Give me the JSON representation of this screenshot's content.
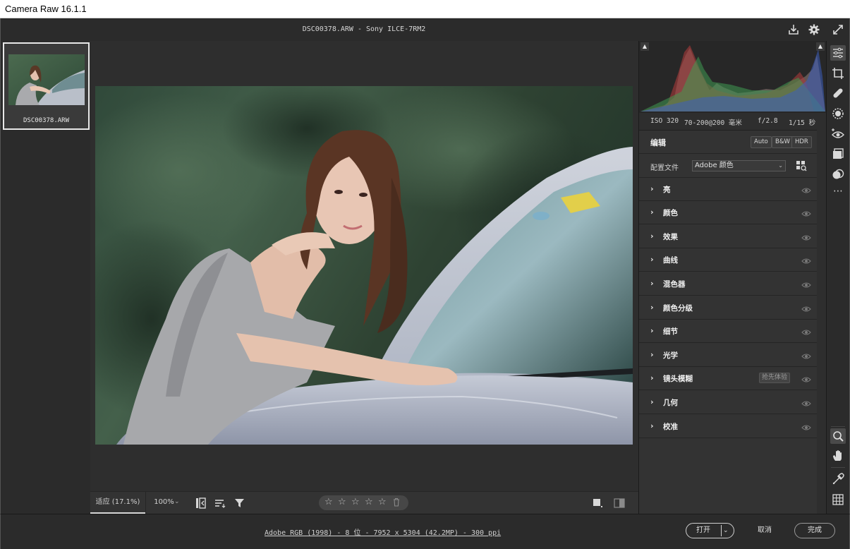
{
  "window": {
    "title": "Camera Raw 16.1.1"
  },
  "header": {
    "file": "DSC00378.ARW -  Sony ILCE-7RM2"
  },
  "filmstrip": {
    "thumb_caption": "DSC00378.ARW"
  },
  "histogram": {
    "exif": {
      "iso": "ISO 320",
      "lens": "70-200@200 毫米",
      "aperture": "f/2.8",
      "shutter": "1/15 秒"
    }
  },
  "edit": {
    "title": "编辑",
    "auto": "Auto",
    "bw": "B&W",
    "hdr": "HDR",
    "profile_label": "配置文件",
    "profile_value": "Adobe 颜色",
    "sections": [
      {
        "label": "亮"
      },
      {
        "label": "颜色"
      },
      {
        "label": "效果"
      },
      {
        "label": "曲线"
      },
      {
        "label": "混色器"
      },
      {
        "label": "颜色分级"
      },
      {
        "label": "细节"
      },
      {
        "label": "光学"
      },
      {
        "label": "镜头模糊",
        "badge": "抢先体验"
      },
      {
        "label": "几何"
      },
      {
        "label": "校准"
      }
    ]
  },
  "bottombar": {
    "fit": "适应 (17.1%)",
    "zoom": "100%"
  },
  "statusbar": {
    "fileinfo": "Adobe RGB (1998) - 8 位 - 7952 x 5304 (42.2MP) - 300 ppi",
    "open": "打开",
    "cancel": "取消",
    "done": "完成"
  },
  "rating": {
    "stars": [
      "☆",
      "☆",
      "☆",
      "☆",
      "☆"
    ]
  },
  "colors": {
    "panel": "#333333",
    "canvas": "#2e2e2e",
    "accent": "#d8d8d8"
  }
}
